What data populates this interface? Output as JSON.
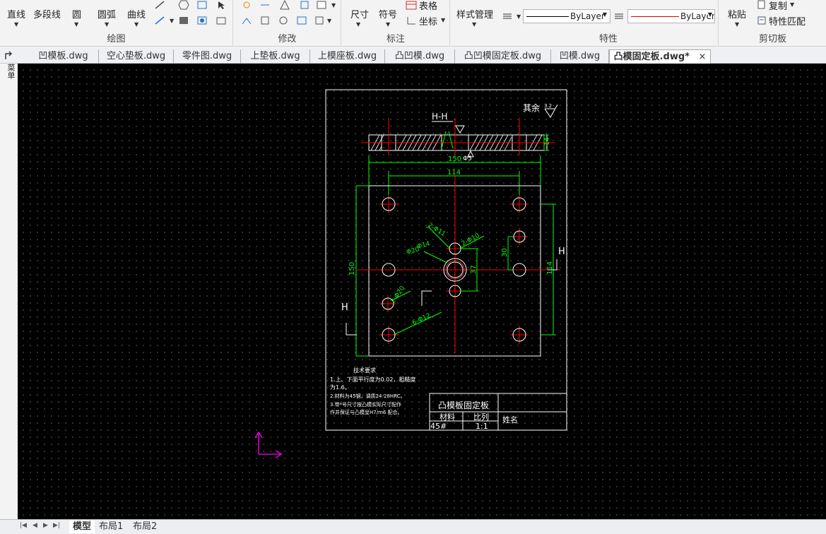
{
  "ribbon": {
    "draw": {
      "title": "绘图",
      "line": "直线",
      "polyline": "多段线",
      "circle": "圆",
      "arc": "圆弧",
      "curve": "曲线"
    },
    "modify": {
      "title": "修改"
    },
    "annotate": {
      "title": "标注",
      "dimension": "尺寸",
      "symbol": "符号",
      "table": "表格",
      "coordinate": "坐标"
    },
    "style": {
      "manage": "样式管理"
    },
    "properties": {
      "title": "特性",
      "linetype": "ByLayer",
      "color": "ByLayer"
    },
    "clipboard": {
      "title": "剪切板",
      "paste": "粘贴",
      "copy": "复制",
      "match": "特性匹配"
    }
  },
  "tabs": [
    {
      "label": "凹模板.dwg"
    },
    {
      "label": "空心垫板.dwg"
    },
    {
      "label": "零件图.dwg"
    },
    {
      "label": "上垫板.dwg"
    },
    {
      "label": "上模座板.dwg"
    },
    {
      "label": "凸凹模.dwg"
    },
    {
      "label": "凸凹模固定板.dwg"
    },
    {
      "label": "凹模.dwg"
    },
    {
      "label": "凸模固定板.dwg*",
      "close": "×"
    }
  ],
  "side_menu": "菜单",
  "drawing": {
    "roughness_note": "其余",
    "roughness_value": "3.2",
    "section_label": "H-H",
    "section_mark_left": "H",
    "section_mark_right": "H",
    "dims": {
      "w150": "150",
      "w114": "114",
      "h150": "150",
      "h114": "114",
      "d30": "30",
      "d37": "37",
      "d14": "14",
      "d2_10": "2-Φ10",
      "d2_11": "2-Φ11",
      "d14b": "Φ14",
      "d20": "Φ20",
      "d6_12": "6-Φ12",
      "d2_20": "2-Φ20",
      "sec_dim": "Φ5"
    },
    "tech": {
      "title": "技术要求",
      "line1": "1.上、下面平行度为0.02，粗糙度",
      "line1b": "为1.6。",
      "line2": "2.材料为45钢，调质24-28HRC。",
      "line3": "3.带*号尺寸按凸模实际尺寸配作",
      "line3b": "作并保证与凸模呈H7/m6 配合。"
    },
    "titleblock": {
      "name": "凸模板固定板",
      "material_label": "材料",
      "scale_label": "比列",
      "designer_label": "姓名",
      "material": "45#",
      "scale": "1:1"
    }
  },
  "layout_tabs": [
    {
      "label": "模型"
    },
    {
      "label": "布局1"
    },
    {
      "label": "布局2"
    }
  ],
  "colors": {
    "dimension": "#00ff00",
    "centerline": "#ff0000",
    "geometry": "#ffffff",
    "ucs": "#ff00ff",
    "background": "#000000"
  }
}
